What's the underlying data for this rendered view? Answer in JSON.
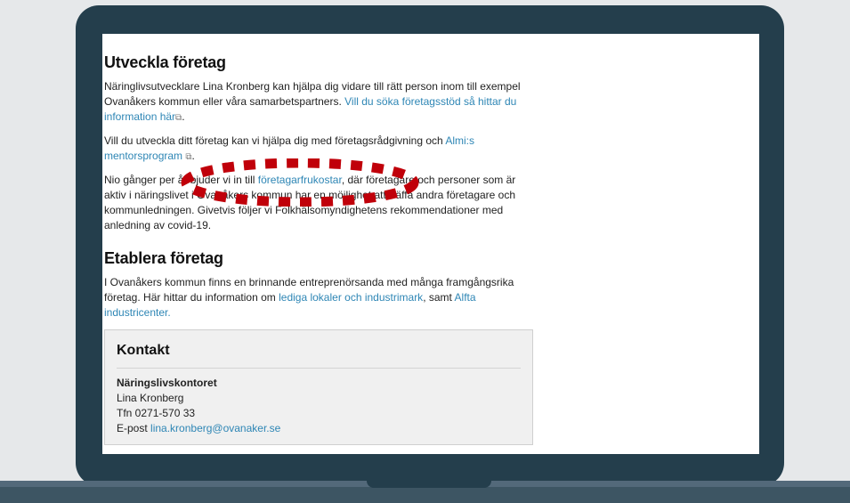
{
  "section1": {
    "heading": "Utveckla företag",
    "p1_text": "Näringlivsutvecklare Lina Kronberg kan hjälpa dig vidare till rätt person inom till exempel Ovanåkers kommun eller våra samarbetspartners.",
    "p1_link": "Vill du söka företagsstöd så hittar du information här",
    "p2_text": "Vill du utveckla ditt företag kan vi hjälpa dig med företagsrådgivning och",
    "p2_link": "Almi:s mentorsprogram",
    "p3_a": "Nio gånger per år bjuder vi in till",
    "p3_link": "företagarfrukostar",
    "p3_b": ", där företagare och personer som är aktiv i näringslivet i Ovanåkers kommun har en möjlighet att träffa andra företagare och kommunledningen. Givetvis följer vi Folkhälsomyndighetens rekommendationer med anledning av covid-19."
  },
  "section2": {
    "heading": "Etablera företag",
    "text_a": "I Ovanåkers kommun finns en brinnande entreprenörsanda med många framgångsrika företag. Här hittar du information om",
    "link1": "lediga lokaler och industrimark",
    "text_b": ", samt",
    "link2": "Alfta industricenter."
  },
  "contact": {
    "heading": "Kontakt",
    "office": "Näringslivskontoret",
    "name": "Lina Kronberg",
    "phone": "Tfn 0271-570 33",
    "email_label": "E-post",
    "email": "lina.kronberg@ovanaker.se"
  },
  "colors": {
    "link": "#2e86b5",
    "annotation": "#c0000a",
    "laptop_frame": "#243e4c"
  },
  "icons": {
    "external_link": "external-link-icon"
  }
}
